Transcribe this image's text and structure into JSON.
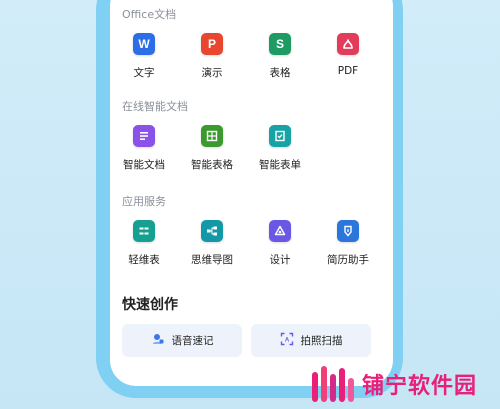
{
  "sections": {
    "office": {
      "title": "Office文档",
      "apps": [
        {
          "label": "文字",
          "icon": "word-icon",
          "letter": "W",
          "color": "#2b6ee8"
        },
        {
          "label": "演示",
          "icon": "presentation-icon",
          "letter": "P",
          "color": "#e8462e"
        },
        {
          "label": "表格",
          "icon": "spreadsheet-icon",
          "letter": "S",
          "color": "#1d9b63"
        },
        {
          "label": "PDF",
          "icon": "pdf-icon",
          "letter": "",
          "color": "#e33b5a"
        }
      ]
    },
    "online": {
      "title": "在线智能文档",
      "apps": [
        {
          "label": "智能文档",
          "icon": "smart-doc-icon",
          "color": "#8a52e8"
        },
        {
          "label": "智能表格",
          "icon": "smart-sheet-icon",
          "color": "#3b9a2e"
        },
        {
          "label": "智能表单",
          "icon": "smart-form-icon",
          "color": "#17a3a6"
        }
      ]
    },
    "services": {
      "title": "应用服务",
      "apps": [
        {
          "label": "轻维表",
          "icon": "light-table-icon",
          "color": "#16a091"
        },
        {
          "label": "思维导图",
          "icon": "mind-map-icon",
          "color": "#1398a8"
        },
        {
          "label": "设计",
          "icon": "design-icon",
          "color": "#6b57e6"
        },
        {
          "label": "简历助手",
          "icon": "resume-icon",
          "color": "#2a76db"
        }
      ]
    }
  },
  "quick_create": {
    "title": "快速创作",
    "buttons": [
      {
        "label": "语音速记",
        "icon": "voice-note-icon"
      },
      {
        "label": "拍照扫描",
        "icon": "photo-scan-icon"
      }
    ]
  },
  "watermark": {
    "text": "铺宁软件园",
    "color": "#e8207a"
  }
}
